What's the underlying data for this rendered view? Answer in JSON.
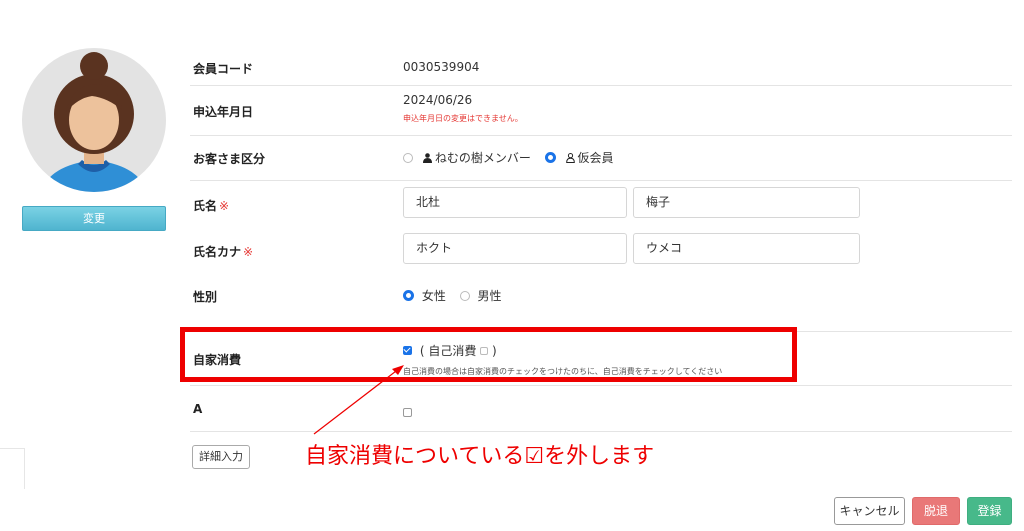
{
  "avatar": {
    "change_label": "変更"
  },
  "form": {
    "member_code": {
      "label": "会員コード",
      "value": "0030539904"
    },
    "apply_date": {
      "label": "申込年月日",
      "value": "2024/06/26",
      "note": "申込年月日の変更はできません。"
    },
    "customer_type": {
      "label": "お客さま区分",
      "options": [
        {
          "label": "ねむの樹メンバー",
          "selected": false,
          "icon": "person-filled-icon"
        },
        {
          "label": "仮会員",
          "selected": true,
          "icon": "person-outline-icon"
        }
      ]
    },
    "name": {
      "label": "氏名",
      "required_mark": "※",
      "last": "北杜",
      "first": "梅子"
    },
    "name_kana": {
      "label": "氏名カナ",
      "required_mark": "※",
      "last": "ホクト",
      "first": "ウメコ"
    },
    "gender": {
      "label": "性別",
      "options": [
        {
          "label": "女性",
          "selected": true
        },
        {
          "label": "男性",
          "selected": false
        }
      ]
    },
    "self_consumption": {
      "label": "自家消費",
      "checked": true,
      "paren_open": "(",
      "sub_label": "自己消費",
      "sub_checked": false,
      "paren_close": ")",
      "note": "自己消費の場合は自家消費のチェックをつけたのちに、自己消費をチェックしてください"
    },
    "a_field": {
      "label": "A",
      "checked": false
    }
  },
  "detail_button": "詳細入力",
  "annotation": {
    "text": "自家消費についている☑を外します",
    "color": "#ee0000"
  },
  "footer": {
    "cancel": "キャンセル",
    "leave": "脱退",
    "register": "登録"
  }
}
